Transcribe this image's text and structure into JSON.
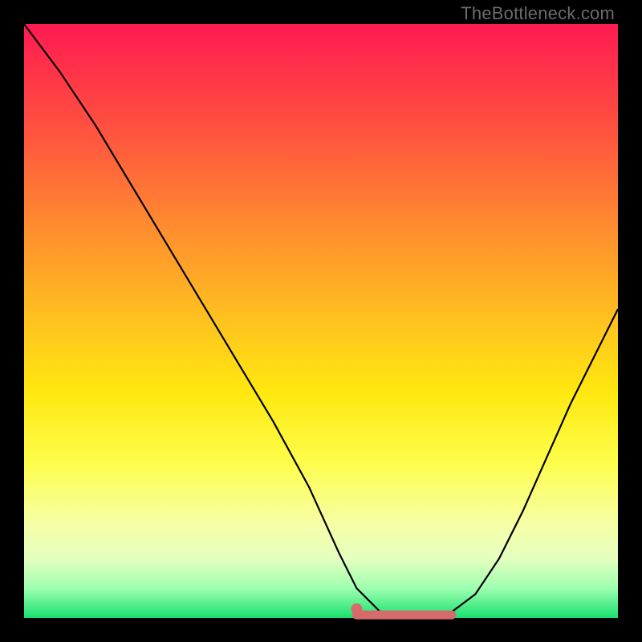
{
  "watermark": "TheBottleneck.com",
  "colors": {
    "curve_stroke": "#000000",
    "highlight_stroke": "#d76a6a",
    "highlight_dot": "#d76a6a"
  },
  "chart_data": {
    "type": "line",
    "title": "",
    "xlabel": "",
    "ylabel": "",
    "xlim": [
      0,
      100
    ],
    "ylim": [
      0,
      100
    ],
    "grid": false,
    "series": [
      {
        "name": "bottleneck-curve",
        "x": [
          0,
          6,
          12,
          18,
          24,
          30,
          36,
          42,
          48,
          53,
          56,
          60,
          64,
          68,
          72,
          76,
          80,
          84,
          88,
          92,
          96,
          100
        ],
        "values": [
          100,
          92,
          83,
          73,
          63,
          53,
          43,
          33,
          22,
          11,
          5,
          1,
          0,
          0,
          1,
          4,
          10,
          18,
          27,
          36,
          44,
          52
        ]
      }
    ],
    "highlight": {
      "name": "optimal-flat-region",
      "x_start": 56,
      "x_end": 72,
      "y": 0.5,
      "dot_x": 56,
      "dot_y": 1.5
    }
  }
}
